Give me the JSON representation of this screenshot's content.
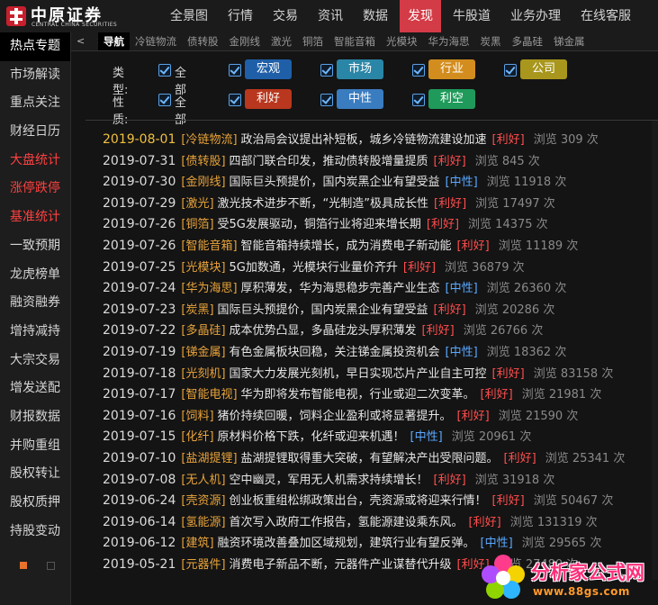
{
  "logo": {
    "name": "中原证券",
    "sub": "CENTRAL CHINA SECURITIES"
  },
  "topnav": [
    "全景图",
    "行情",
    "交易",
    "资讯",
    "数据",
    "发现",
    "牛股道",
    "业务办理",
    "在线客服"
  ],
  "sidebar": [
    {
      "label": "热点专题",
      "style": "active"
    },
    {
      "label": "市场解读",
      "style": ""
    },
    {
      "label": "重点关注",
      "style": ""
    },
    {
      "label": "财经日历",
      "style": ""
    },
    {
      "label": "大盘统计",
      "style": "red"
    },
    {
      "label": "涨停跌停",
      "style": "red"
    },
    {
      "label": "基准统计",
      "style": "red"
    },
    {
      "label": "一致预期",
      "style": ""
    },
    {
      "label": "龙虎榜单",
      "style": ""
    },
    {
      "label": "融资融券",
      "style": ""
    },
    {
      "label": "增持减持",
      "style": ""
    },
    {
      "label": "大宗交易",
      "style": ""
    },
    {
      "label": "增发送配",
      "style": ""
    },
    {
      "label": "财报数据",
      "style": ""
    },
    {
      "label": "并购重组",
      "style": ""
    },
    {
      "label": "股权转让",
      "style": ""
    },
    {
      "label": "股权质押",
      "style": ""
    },
    {
      "label": "持股变动",
      "style": ""
    }
  ],
  "subtabs": {
    "arrows": "< >",
    "items": [
      "导航",
      "冷链物流",
      "债转股",
      "金刚线",
      "激光",
      "铜箔",
      "智能音箱",
      "光模块",
      "华为海思",
      "炭黑",
      "多晶硅",
      "锑金属"
    ]
  },
  "filters": {
    "type_label": "类型:",
    "type_all": "全部",
    "type_options": [
      {
        "label": "宏观",
        "color": "#1f5fa8"
      },
      {
        "label": "市场",
        "color": "#2a86a6"
      },
      {
        "label": "行业",
        "color": "#d38d1e"
      },
      {
        "label": "公司",
        "color": "#a8971c"
      }
    ],
    "nature_label": "性质:",
    "nature_all": "全部",
    "nature_options": [
      {
        "label": "利好",
        "color": "#b8371e"
      },
      {
        "label": "中性",
        "color": "#3a7cc0"
      },
      {
        "label": "利空",
        "color": "#1f9a5a"
      }
    ]
  },
  "news": [
    {
      "date": "2019-08-01",
      "cat": "[冷链物流]",
      "title": "政治局会议提出补短板，城乡冷链物流建设加速",
      "sent": "[利好]",
      "views": "浏览 309 次"
    },
    {
      "date": "2019-07-31",
      "cat": "[债转股]",
      "title": "四部门联合印发，推动债转股增量提质",
      "sent": "[利好]",
      "views": "浏览 845 次"
    },
    {
      "date": "2019-07-30",
      "cat": "[金刚线]",
      "title": "国际巨头预提价，国内炭黑企业有望受益",
      "sent": "[中性]",
      "views": "浏览 11918 次"
    },
    {
      "date": "2019-07-29",
      "cat": "[激光]",
      "title": "激光技术进步不断，“光制造”极具成长性",
      "sent": "[利好]",
      "views": "浏览 17497 次"
    },
    {
      "date": "2019-07-26",
      "cat": "[铜箔]",
      "title": "受5G发展驱动，铜箔行业将迎来增长期",
      "sent": "[利好]",
      "views": "浏览 14375 次"
    },
    {
      "date": "2019-07-26",
      "cat": "[智能音箱]",
      "title": "智能音箱持续增长，成为消费电子新动能",
      "sent": "[利好]",
      "views": "浏览 11189 次"
    },
    {
      "date": "2019-07-25",
      "cat": "[光模块]",
      "title": "5G加数通，光模块行业量价齐升",
      "sent": "[利好]",
      "views": "浏览 36879 次"
    },
    {
      "date": "2019-07-24",
      "cat": "[华为海思]",
      "title": "厚积薄发，华为海思稳步完善产业生态",
      "sent": "[中性]",
      "views": "浏览 26360 次"
    },
    {
      "date": "2019-07-23",
      "cat": "[炭黑]",
      "title": "国际巨头预提价，国内炭黑企业有望受益",
      "sent": "[利好]",
      "views": "浏览 20286 次"
    },
    {
      "date": "2019-07-22",
      "cat": "[多晶硅]",
      "title": "成本优势凸显，多晶硅龙头厚积薄发",
      "sent": "[利好]",
      "views": "浏览 26766 次"
    },
    {
      "date": "2019-07-19",
      "cat": "[锑金属]",
      "title": "有色金属板块回稳，关注锑金属投资机会",
      "sent": "[中性]",
      "views": "浏览 18362 次"
    },
    {
      "date": "2019-07-18",
      "cat": "[光刻机]",
      "title": "国家大力发展光刻机，早日实现芯片产业自主可控",
      "sent": "[利好]",
      "views": "浏览 83158 次"
    },
    {
      "date": "2019-07-17",
      "cat": "[智能电视]",
      "title": "华为即将发布智能电视，行业或迎二次变革。",
      "sent": "[利好]",
      "views": "浏览 21981 次"
    },
    {
      "date": "2019-07-16",
      "cat": "[饲料]",
      "title": "猪价持续回暖，饲料企业盈利或将显著提升。",
      "sent": "[利好]",
      "views": "浏览 21590 次"
    },
    {
      "date": "2019-07-15",
      "cat": "[化纤]",
      "title": "原材料价格下跌，化纤或迎来机遇！",
      "sent": "[中性]",
      "views": "浏览 20961 次"
    },
    {
      "date": "2019-07-10",
      "cat": "[盐湖提锂]",
      "title": "盐湖提锂取得重大突破，有望解决产出受限问题。",
      "sent": "[利好]",
      "views": "浏览 25341 次"
    },
    {
      "date": "2019-07-08",
      "cat": "[无人机]",
      "title": "空中幽灵，军用无人机需求持续增长！",
      "sent": "[利好]",
      "views": "浏览 31918 次"
    },
    {
      "date": "2019-06-24",
      "cat": "[壳资源]",
      "title": "创业板重组松绑政策出台，壳资源或将迎来行情！",
      "sent": "[利好]",
      "views": "浏览 50467 次"
    },
    {
      "date": "2019-06-14",
      "cat": "[氢能源]",
      "title": "首次写入政府工作报告，氢能源建设乘东风。",
      "sent": "[利好]",
      "views": "浏览 131319 次"
    },
    {
      "date": "2019-06-12",
      "cat": "[建筑]",
      "title": "融资环境改善叠加区域规划，建筑行业有望反弹。",
      "sent": "[中性]",
      "views": "浏览 29565 次"
    },
    {
      "date": "2019-05-21",
      "cat": "[元器件]",
      "title": "消费电子新品不断，元器件产业谋替代升级",
      "sent": "[利好]",
      "views": "浏览 27480 次"
    }
  ],
  "watermark": {
    "title": "分析家公式网",
    "url": "www.88gs.com"
  }
}
